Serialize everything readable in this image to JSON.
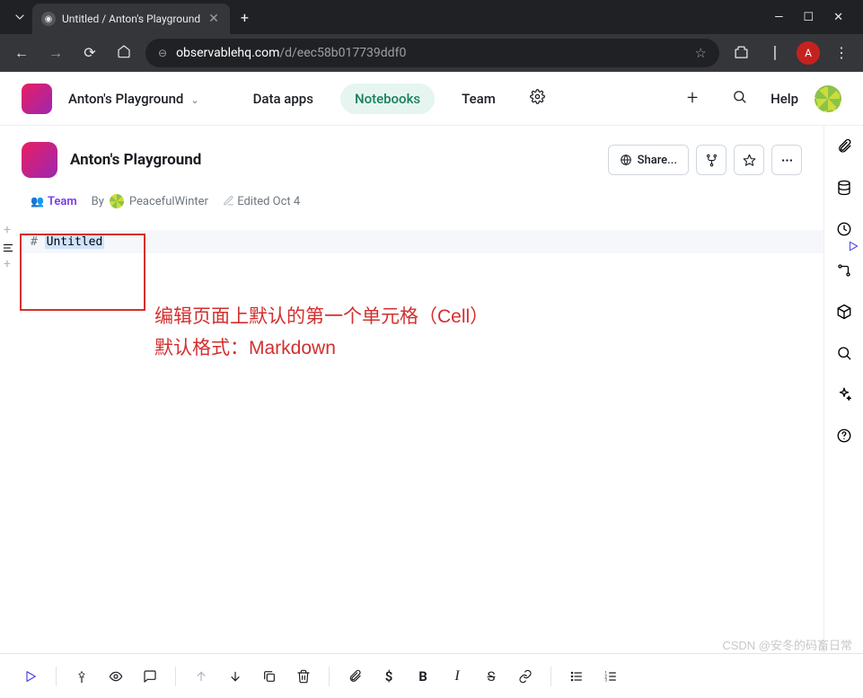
{
  "browser": {
    "tab_title": "Untitled / Anton's Playground",
    "url_domain": "observablehq.com",
    "url_path": "/d/eec58b017739ddf0",
    "avatar_letter": "A"
  },
  "header": {
    "workspace": "Anton's Playground",
    "nav": {
      "data_apps": "Data apps",
      "notebooks": "Notebooks",
      "team": "Team"
    },
    "help": "Help"
  },
  "project": {
    "title": "Anton's Playground",
    "share": "Share..."
  },
  "meta": {
    "team_label": "Team",
    "by_label": "By",
    "author": "PeacefulWinter",
    "edited": "Edited Oct 4"
  },
  "cell": {
    "hash": "# ",
    "title": "Untitled"
  },
  "annotation": {
    "line1": "编辑页面上默认的第一个单元格（Cell）",
    "line2": "默认格式：Markdown"
  },
  "watermark": "CSDN @安冬的码畜日常"
}
